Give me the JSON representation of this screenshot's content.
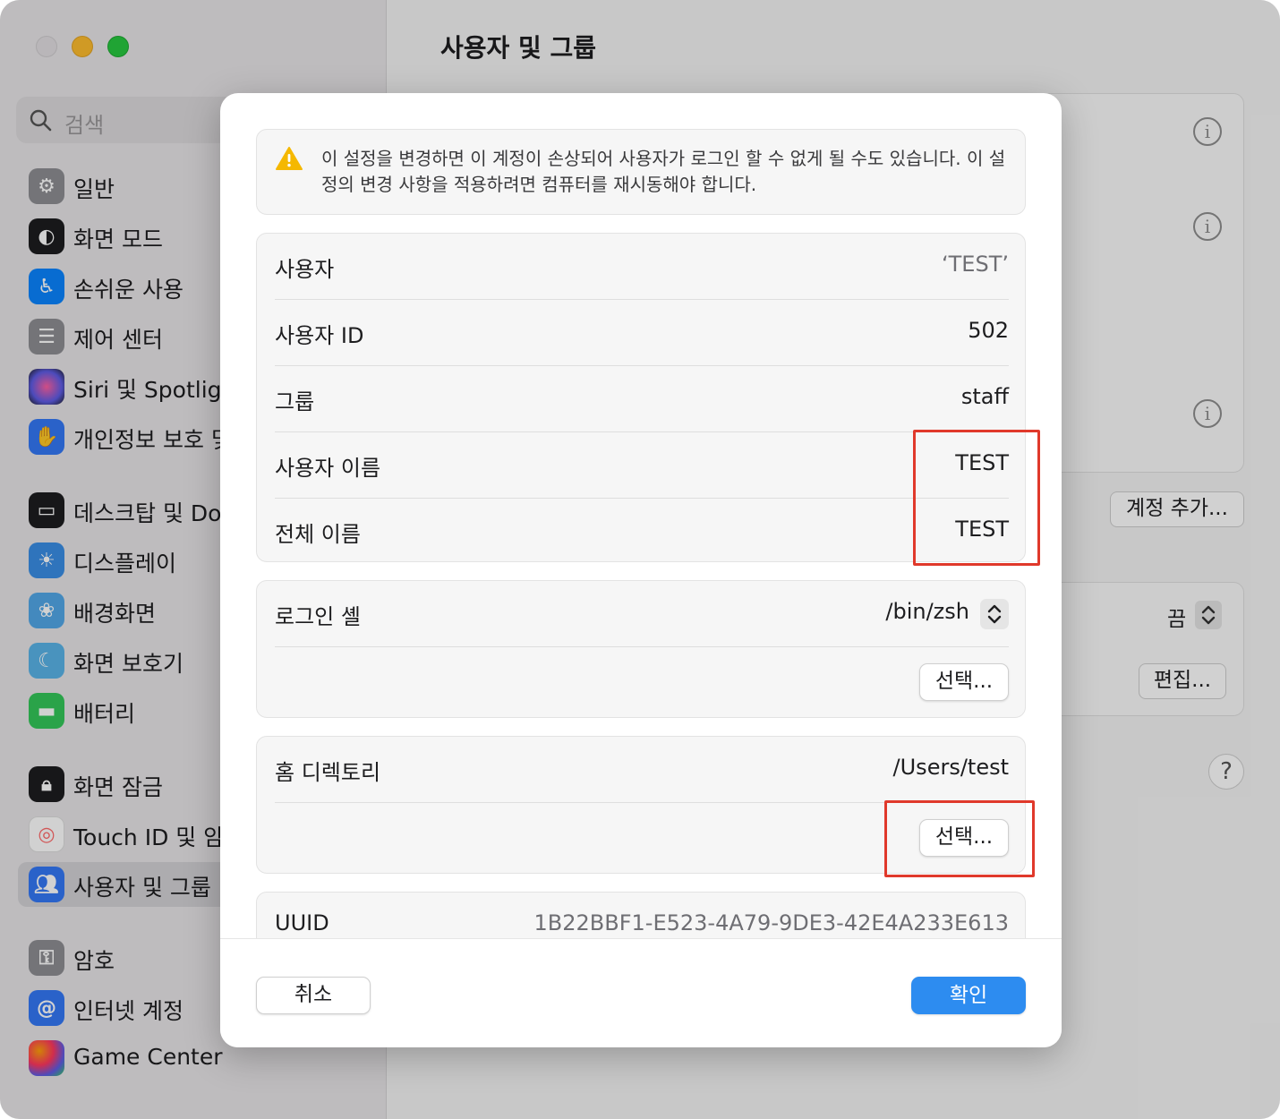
{
  "window": {
    "title": "사용자 및 그룹"
  },
  "sidebar": {
    "search_placeholder": "검색",
    "items": [
      {
        "label": "일반",
        "icon": "gear-icon",
        "color": "#8e8e93"
      },
      {
        "label": "화면 모드",
        "icon": "appearance-icon",
        "color": "#1d1d1f"
      },
      {
        "label": "손쉬운 사용",
        "icon": "accessibility-icon",
        "color": "#0a84ff"
      },
      {
        "label": "제어 센터",
        "icon": "control-center-icon",
        "color": "#8e8e93"
      },
      {
        "label": "Siri 및 Spotlight",
        "icon": "siri-icon",
        "color": "#5e5ce6"
      },
      {
        "label": "개인정보 보호 및 보안",
        "icon": "hand-icon",
        "color": "#3478f6"
      },
      {
        "label": "데스크탑 및 Dock",
        "icon": "dock-icon",
        "color": "#1d1d1f"
      },
      {
        "label": "디스플레이",
        "icon": "display-icon",
        "color": "#3a8ee6"
      },
      {
        "label": "배경화면",
        "icon": "wallpaper-icon",
        "color": "#52a8e8"
      },
      {
        "label": "화면 보호기",
        "icon": "screensaver-icon",
        "color": "#5ab4e8"
      },
      {
        "label": "배터리",
        "icon": "battery-icon",
        "color": "#34c759"
      },
      {
        "label": "화면 잠금",
        "icon": "lock-icon",
        "color": "#1d1d1f"
      },
      {
        "label": "Touch ID 및 암호",
        "icon": "fingerprint-icon",
        "color": "#ff6b6b"
      },
      {
        "label": "사용자 및 그룹",
        "icon": "users-icon",
        "color": "#3478f6"
      },
      {
        "label": "암호",
        "icon": "key-icon",
        "color": "#8e8e93"
      },
      {
        "label": "인터넷 계정",
        "icon": "at-icon",
        "color": "#3478f6"
      },
      {
        "label": "Game Center",
        "icon": "game-center-icon",
        "color": "#ff9f0a"
      }
    ]
  },
  "main": {
    "add_account_label": "계정 추가...",
    "auto_login_value": "끔",
    "edit_label": "편집...",
    "help_label": "?"
  },
  "dialog": {
    "warning_text": "이 설정을 변경하면 이 계정이 손상되어 사용자가 로그인 할 수 없게 될 수도 있습니다. 이 설정의 변경 사항을 적용하려면 컴퓨터를 재시동해야 합니다.",
    "fields": [
      {
        "label": "사용자",
        "value": "‘TEST’"
      },
      {
        "label": "사용자 ID",
        "value": "502"
      },
      {
        "label": "그룹",
        "value": "staff"
      },
      {
        "label": "사용자 이름",
        "value": "TEST"
      },
      {
        "label": "전체 이름",
        "value": "TEST"
      }
    ],
    "login_shell": {
      "label": "로그인 셸",
      "value": "/bin/zsh",
      "choose_label": "선택..."
    },
    "home_directory": {
      "label": "홈 디렉토리",
      "value": "/Users/test",
      "choose_label": "선택..."
    },
    "uuid": {
      "label": "UUID",
      "value": "1B22BBF1-E523-4A79-9DE3-42E4A233E613"
    },
    "cancel_label": "취소",
    "ok_label": "확인"
  },
  "colors": {
    "accent": "#2d8cf0",
    "annotation": "#e0392b",
    "warning": "#f5b800"
  }
}
